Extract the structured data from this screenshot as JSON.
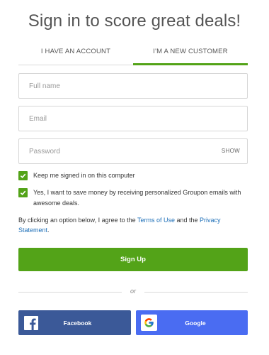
{
  "header": {
    "title": "Sign in to score great deals!"
  },
  "tabs": [
    {
      "label": "I HAVE AN ACCOUNT",
      "active": false
    },
    {
      "label": "I'M A NEW CUSTOMER",
      "active": true
    }
  ],
  "form": {
    "full_name": {
      "placeholder": "Full name",
      "value": ""
    },
    "email": {
      "placeholder": "Email",
      "value": ""
    },
    "password": {
      "placeholder": "Password",
      "value": "",
      "toggle_label": "SHOW"
    }
  },
  "checkboxes": {
    "keep_signed_in": {
      "label": "Keep me signed in on this computer",
      "checked": true
    },
    "marketing": {
      "label": "Yes, I want to save money by receiving personalized Groupon emails with awesome deals.",
      "checked": true
    }
  },
  "agreement": {
    "prefix": "By clicking an option below, I agree to the ",
    "terms_link": "Terms of Use",
    "middle": " and the ",
    "privacy_link": "Privacy Statement",
    "suffix": "."
  },
  "signup_button": "Sign Up",
  "divider_text": "or",
  "social": {
    "facebook_label": "Facebook",
    "google_label": "Google"
  },
  "colors": {
    "accent_green": "#53a318",
    "link_blue": "#1d6fb8",
    "facebook_blue": "#3b5998",
    "google_blue": "#4a6cf2"
  },
  "icons": {
    "checkbox": "checkmark-icon",
    "facebook": "facebook-icon",
    "google": "google-icon"
  }
}
